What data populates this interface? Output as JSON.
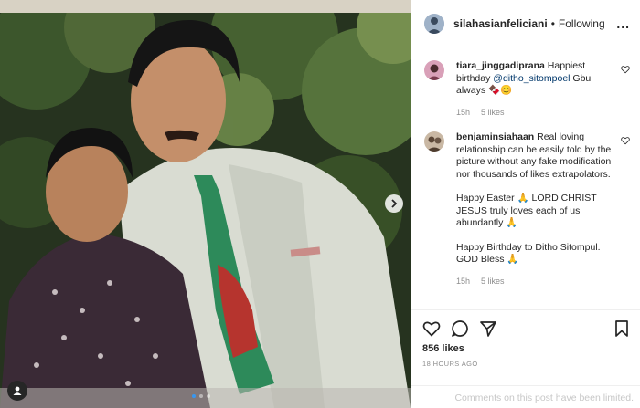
{
  "media": {
    "icons": {
      "next": "chevron-right-icon",
      "tag": "user-tag-icon"
    },
    "carousel": {
      "slides": 3,
      "active_slide": 1
    }
  },
  "header": {
    "username": "silahasianfeliciani",
    "separator": "•",
    "follow_status": "Following",
    "more_label": "..."
  },
  "comments": [
    {
      "username": "tiara_jinggadiprana",
      "text_before": "Happiest birthday ",
      "mention": "@ditho_sitompoel",
      "text_after": " Gbu always 🍫😊",
      "time": "15h",
      "likes": "5 likes"
    },
    {
      "username": "benjaminsiahaan",
      "paragraph_1": "Real loving relationship can be easily told by the picture without any fake modification nor thousands of likes extrapolators.",
      "paragraph_2": "Happy Easter 🙏 LORD CHRIST JESUS truly loves each of us abundantly 🙏",
      "paragraph_3": "Happy Birthday to Ditho Sitompul. GOD Bless 🙏",
      "time": "15h",
      "likes": "5 likes"
    }
  ],
  "actions": {
    "icons": [
      "heart-icon",
      "comment-icon",
      "share-icon",
      "bookmark-icon"
    ],
    "likes_count": "856 likes",
    "timestamp": "18 HOURS AGO",
    "comments_limited": "Comments on this post have been limited."
  }
}
